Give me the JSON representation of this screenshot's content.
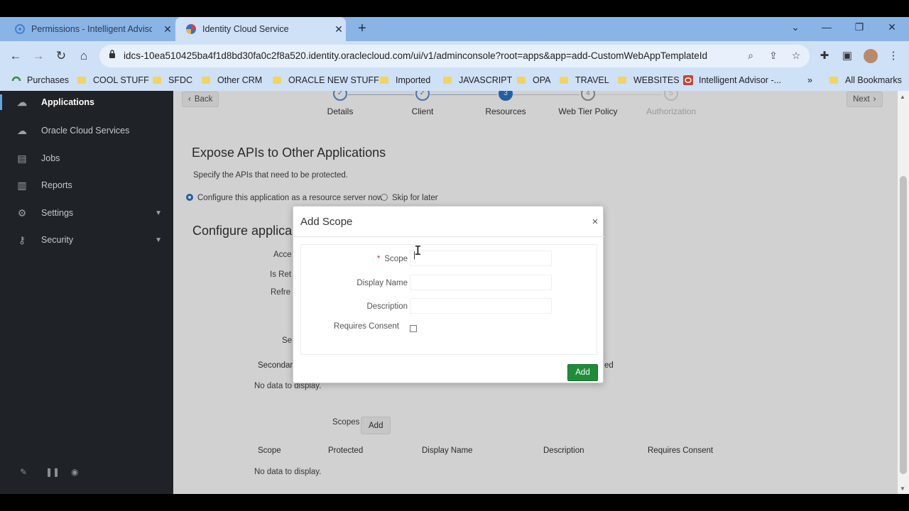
{
  "browser": {
    "tabs": [
      {
        "title": "Permissions - Intelligent Advisor",
        "close": "✕"
      },
      {
        "title": "Identity Cloud Service",
        "close": "✕"
      }
    ],
    "new_tab": "+",
    "window": {
      "down": "⌄",
      "minimize": "—",
      "restore": "❐",
      "close": "✕"
    },
    "nav": {
      "back": "←",
      "forward": "→",
      "reload": "↻",
      "home": "⌂"
    },
    "url": "idcs-10ea510425ba4f1d8bd30fa0c2f8a520.identity.oraclecloud.com/ui/v1/adminconsole?root=apps&app=add-CustomWebAppTemplateId",
    "omni_icons": {
      "zoom": "⌕",
      "share": "⇪",
      "star": "☆"
    },
    "toolbar_icons": {
      "extensions": "✚",
      "sidepanel": "▣",
      "menu": "⋮"
    },
    "bookmarks": [
      {
        "label": "Purchases",
        "type": "site"
      },
      {
        "label": "COOL STUFF",
        "type": "folder"
      },
      {
        "label": "SFDC",
        "type": "folder"
      },
      {
        "label": "Other CRM",
        "type": "folder"
      },
      {
        "label": "ORACLE NEW STUFF",
        "type": "folder"
      },
      {
        "label": "Imported",
        "type": "folder"
      },
      {
        "label": "JAVASCRIPT",
        "type": "folder"
      },
      {
        "label": "OPA",
        "type": "folder"
      },
      {
        "label": "TRAVEL",
        "type": "folder"
      },
      {
        "label": "WEBSITES",
        "type": "folder"
      },
      {
        "label": "Intelligent Advisor -...",
        "type": "site"
      }
    ],
    "bookmarks_more": "»",
    "all_bookmarks": "All Bookmarks"
  },
  "sidebar": {
    "items": [
      {
        "label": "Applications",
        "icon": "cloud-apps-icon",
        "active": true
      },
      {
        "label": "Oracle Cloud Services",
        "icon": "cloud-icon"
      },
      {
        "label": "Jobs",
        "icon": "jobs-icon"
      },
      {
        "label": "Reports",
        "icon": "reports-icon"
      },
      {
        "label": "Settings",
        "icon": "gear-icon",
        "expandable": true
      },
      {
        "label": "Security",
        "icon": "key-icon",
        "expandable": true
      }
    ],
    "colors": {
      "background": "#1f2327",
      "active_bar": "#5ea7e6"
    }
  },
  "wizard": {
    "back": "Back",
    "next": "Next",
    "steps": [
      {
        "num": "✓",
        "label": "Details",
        "state": "done"
      },
      {
        "num": "✓",
        "label": "Client",
        "state": "done"
      },
      {
        "num": "3",
        "label": "Resources",
        "state": "active"
      },
      {
        "num": "4",
        "label": "Web Tier Policy",
        "state": "todo"
      },
      {
        "num": "5",
        "label": "Authorization",
        "state": "disabled"
      }
    ]
  },
  "page": {
    "title": "Expose APIs to Other Applications",
    "subtitle": "Specify the APIs that need to be protected.",
    "radio_configure": "Configure this application as a resource server now",
    "radio_skip": "Skip for later",
    "section2": "Configure applica",
    "partial_labels": {
      "access": "Acce",
      "is_refresh": "Is Ret",
      "refresh": "Refre",
      "se": "Se"
    },
    "secondary": "Secondar",
    "ed": "ed",
    "no_data_1": "No data to display.",
    "scopes_label": "Scopes",
    "scopes_add": "Add",
    "table_headers": [
      "Scope",
      "Protected",
      "Display Name",
      "Description",
      "Requires Consent"
    ],
    "no_data_2": "No data to display."
  },
  "modal": {
    "title": "Add Scope",
    "close": "×",
    "fields": [
      {
        "label": "Scope",
        "required": true,
        "value": "|"
      },
      {
        "label": "Display Name",
        "value": ""
      },
      {
        "label": "Description",
        "value": ""
      }
    ],
    "requires_consent": "Requires Consent",
    "add": "Add",
    "add_color": "#1f8c3a"
  }
}
